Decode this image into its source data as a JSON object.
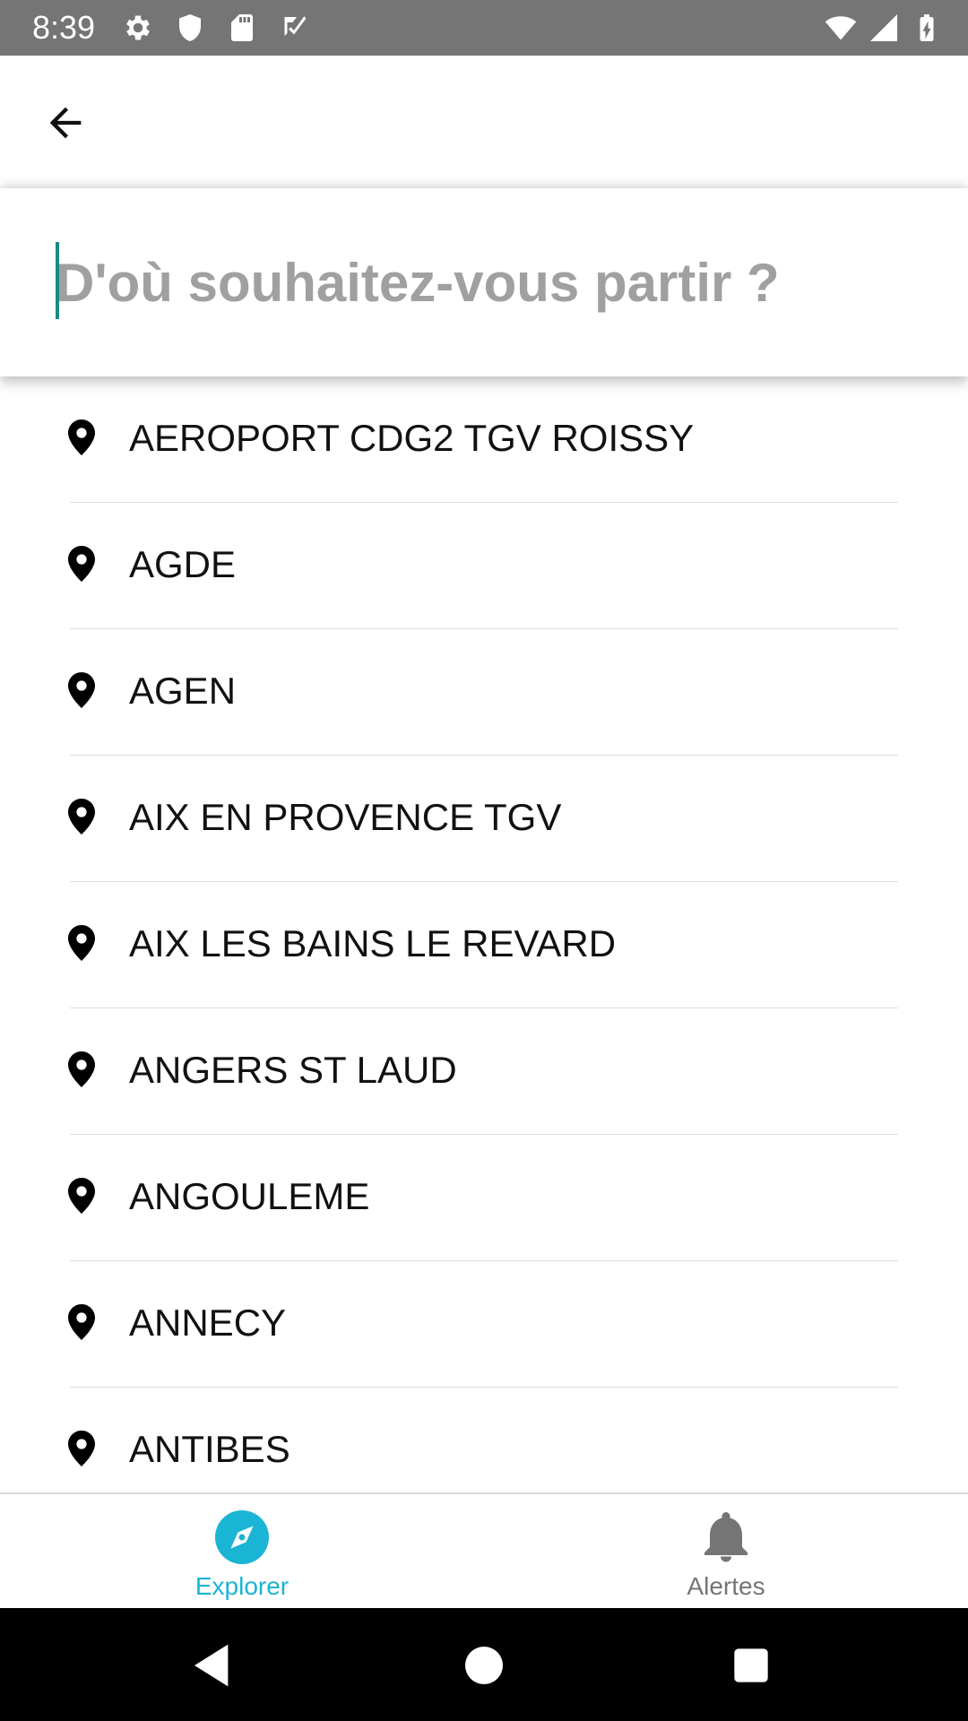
{
  "status_bar": {
    "time": "8:39",
    "left_icons": [
      "gear-icon",
      "shield-icon",
      "sd-card-icon",
      "checklist-icon"
    ],
    "right_icons": [
      "wifi-icon",
      "cell-signal-icon",
      "battery-charging-icon"
    ],
    "background": "#757575"
  },
  "top_bar": {
    "back_icon": "arrow-left-icon"
  },
  "search": {
    "placeholder": "D'où souhaitez-vous partir ?",
    "value": "",
    "caret_color": "#1a8a7e"
  },
  "stations": [
    {
      "label": "AEROPORT CDG2 TGV ROISSY",
      "icon": "location-pin-icon"
    },
    {
      "label": "AGDE",
      "icon": "location-pin-icon"
    },
    {
      "label": "AGEN",
      "icon": "location-pin-icon"
    },
    {
      "label": "AIX EN PROVENCE TGV",
      "icon": "location-pin-icon"
    },
    {
      "label": "AIX LES BAINS LE REVARD",
      "icon": "location-pin-icon"
    },
    {
      "label": "ANGERS ST LAUD",
      "icon": "location-pin-icon"
    },
    {
      "label": "ANGOULEME",
      "icon": "location-pin-icon"
    },
    {
      "label": "ANNECY",
      "icon": "location-pin-icon"
    },
    {
      "label": "ANTIBES",
      "icon": "location-pin-icon"
    }
  ],
  "bottom_nav": {
    "items": [
      {
        "label": "Explorer",
        "icon": "compass-icon",
        "active": true,
        "color": "#1ab4d4"
      },
      {
        "label": "Alertes",
        "icon": "bell-icon",
        "active": false,
        "color": "#757575"
      }
    ]
  },
  "system_nav": {
    "buttons": [
      "back-triangle-icon",
      "home-circle-icon",
      "recents-square-icon"
    ]
  }
}
